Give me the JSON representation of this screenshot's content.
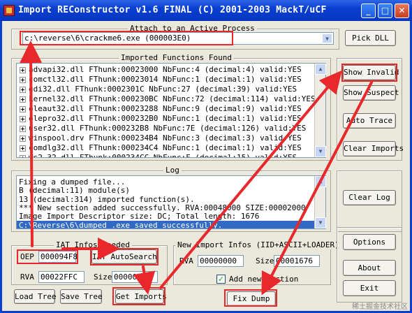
{
  "window": {
    "title": "Import REConstructor v1.6 FINAL (C) 2001-2003 MackT/uCF",
    "minimize": "_",
    "maximize": "□",
    "close": "✕"
  },
  "attach": {
    "label": "Attach to an Active Process",
    "process": "c:\\reverse\\6\\crackme6.exe (000003E0)",
    "pick_dll": "Pick DLL"
  },
  "imports": {
    "label": "Imported Functions Found",
    "items": [
      "advapi32.dll FThunk:00023000 NbFunc:4 (decimal:4) valid:YES",
      "comctl32.dll FThunk:00023014 NbFunc:1 (decimal:1) valid:YES",
      "gdi32.dll FThunk:0002301C NbFunc:27 (decimal:39) valid:YES",
      "kernel32.dll FThunk:000230BC NbFunc:72 (decimal:114) valid:YES",
      "oleaut32.dll FThunk:00023288 NbFunc:9 (decimal:9) valid:YES",
      "olepro32.dll FThunk:000232B0 NbFunc:1 (decimal:1) valid:YES",
      "user32.dll FThunk:000232B8 NbFunc:7E (decimal:126) valid:YES",
      "winspool.drv FThunk:000234B4 NbFunc:3 (decimal:3) valid:YES",
      "comdlg32.dll FThunk:000234C4 NbFunc:1 (decimal:1) valid:YES",
      "ws2_32.dll FThunk:000234CC NbFunc:F (decimal:15) valid:YES"
    ]
  },
  "side_buttons": {
    "show_invalid": "Show Invalid",
    "show_suspect": "Show Suspect",
    "auto_trace": "Auto Trace",
    "clear_imports": "Clear Imports",
    "clear_log": "Clear Log",
    "options": "Options",
    "about": "About",
    "exit": "Exit"
  },
  "log": {
    "label": "Log",
    "lines": [
      "Fixing a dumped file...",
      "B (decimal:11) module(s)",
      "13 (decimal:314) imported function(s).",
      "*** New section added successfully. RVA:00048000 SIZE:00002000",
      "Image Import Descriptor size: DC; Total length: 1676",
      "C:\\Reverse\\6\\dumped_.exe saved successfully."
    ]
  },
  "iat": {
    "label": "IAT Infos needed",
    "oep_label": "OEP",
    "oep_value": "000094F8",
    "autosearch": "IAT AutoSearch",
    "rva_label": "RVA",
    "rva_value": "00022FFC",
    "size_label": "Size",
    "size_value": "00000518",
    "load_tree": "Load Tree",
    "save_tree": "Save Tree",
    "get_imports": "Get Imports"
  },
  "new_import": {
    "label": "New Import Infos (IID+ASCII+LOADER)",
    "rva_label": "RVA",
    "rva_value": "00000000",
    "size_label": "Size",
    "size_value": "00001676",
    "add_section_label": "Add new section",
    "add_section_checked": true,
    "fix_dump": "Fix Dump"
  },
  "watermark": "稀土掘金技术社区",
  "colors": {
    "annotation_red": "#e8282a",
    "selection_blue": "#316ac5",
    "titlebar_blue": "#0a3fd0"
  }
}
